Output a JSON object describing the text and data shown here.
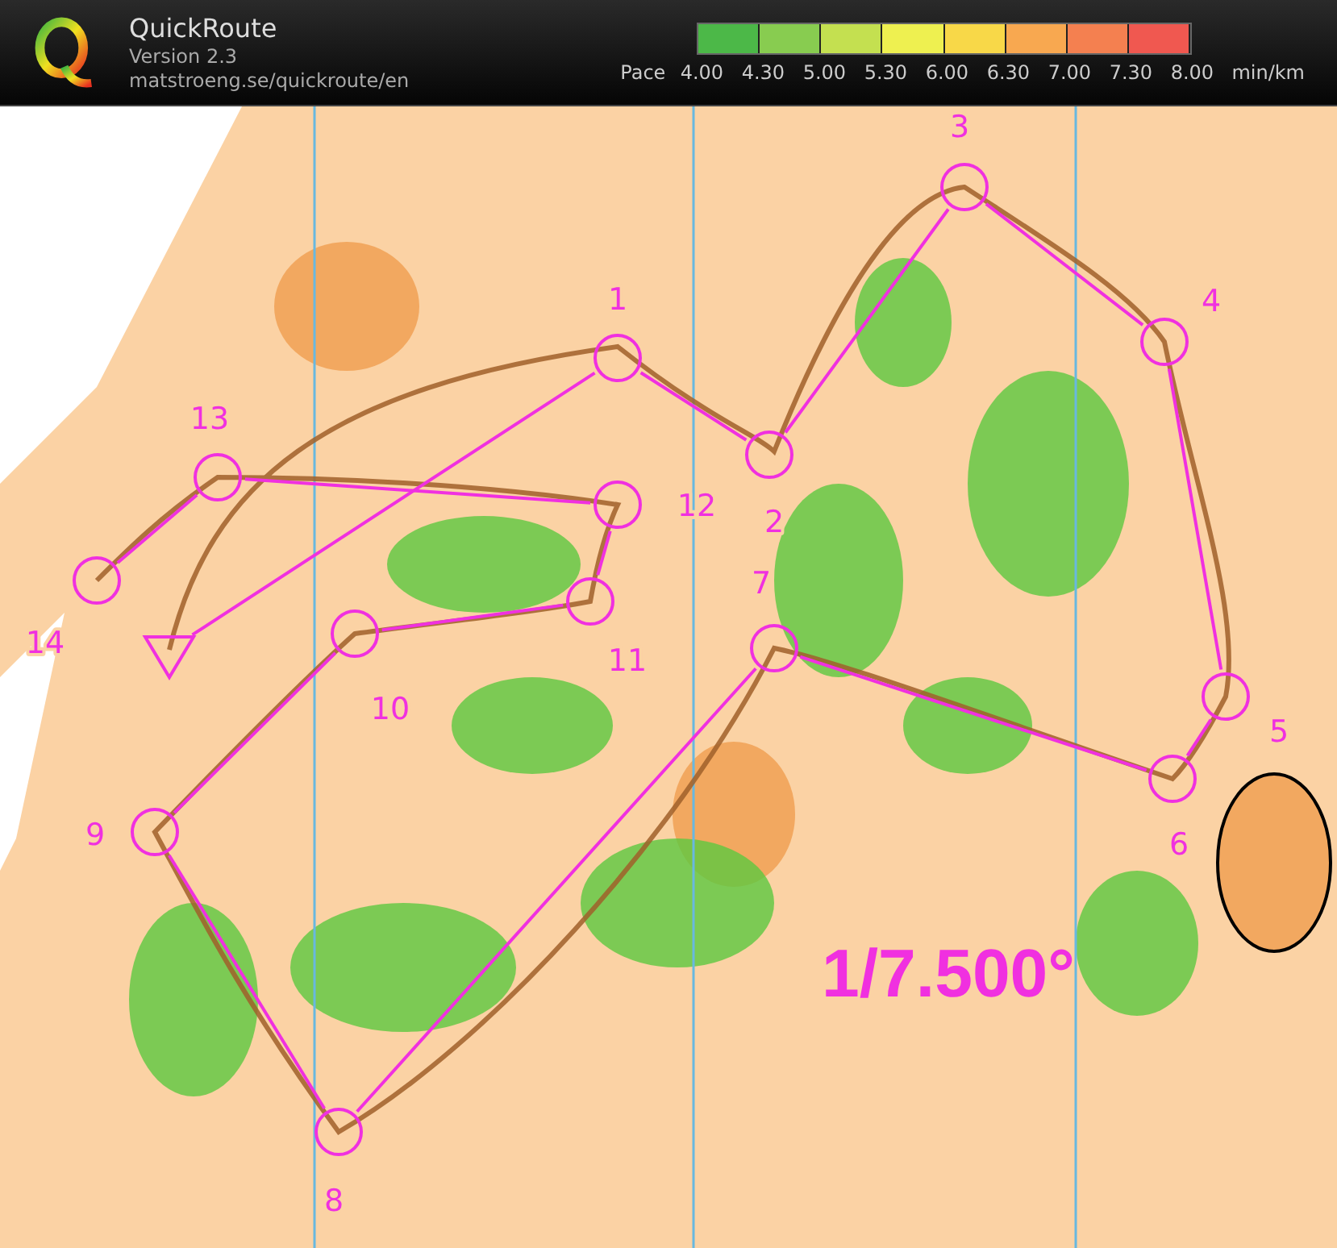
{
  "app": {
    "title": "QuickRoute",
    "version": "Version 2.3",
    "url": "matstroeng.se/quickroute/en"
  },
  "pace_legend": {
    "label": "Pace",
    "unit": "min/km",
    "ticks": [
      "4.00",
      "4.30",
      "5.00",
      "5.30",
      "6.00",
      "6.30",
      "7.00",
      "7.30",
      "8.00"
    ],
    "segments": [
      {
        "color": "#4cb848"
      },
      {
        "color": "#88cc50"
      },
      {
        "color": "#c4e050"
      },
      {
        "color": "#eef050"
      },
      {
        "color": "#f8d848"
      },
      {
        "color": "#f8a850"
      },
      {
        "color": "#f48050"
      },
      {
        "color": "#f05850"
      }
    ]
  },
  "course": {
    "scale": "1/7.500°",
    "controls": [
      {
        "kind": "start"
      },
      {
        "kind": "control",
        "label": "1"
      },
      {
        "kind": "control",
        "label": "2"
      },
      {
        "kind": "control",
        "label": "3"
      },
      {
        "kind": "control",
        "label": "4"
      },
      {
        "kind": "control",
        "label": "5"
      },
      {
        "kind": "control",
        "label": "6"
      },
      {
        "kind": "control",
        "label": "7"
      },
      {
        "kind": "control",
        "label": "8"
      },
      {
        "kind": "control",
        "label": "9"
      },
      {
        "kind": "control",
        "label": "10"
      },
      {
        "kind": "control",
        "label": "11"
      },
      {
        "kind": "control",
        "label": "12"
      },
      {
        "kind": "control",
        "label": "13"
      },
      {
        "kind": "control",
        "label": "14"
      }
    ]
  }
}
